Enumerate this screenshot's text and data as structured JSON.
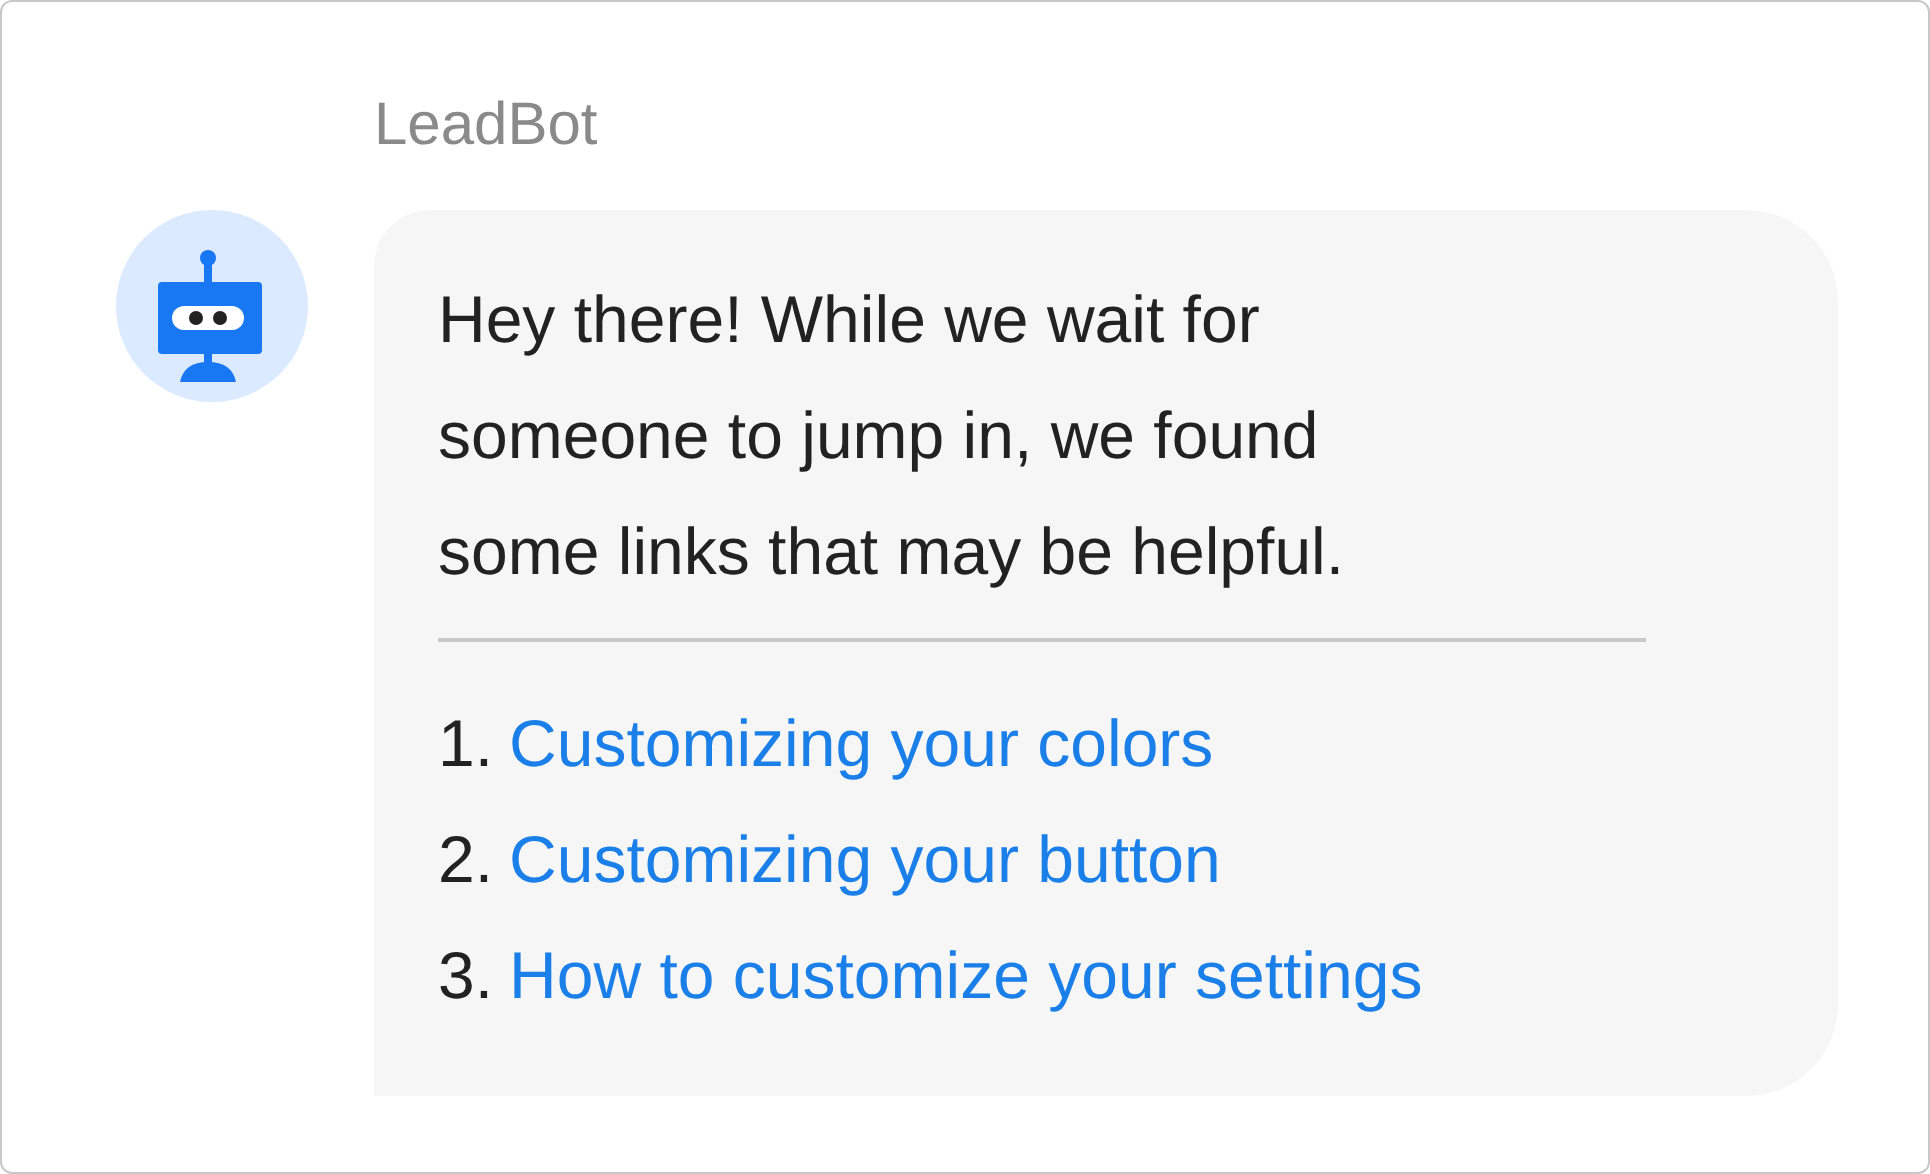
{
  "sender": "LeadBot",
  "message": [
    "Hey there! While we wait for",
    "someone to jump in, we found",
    "some links that may be helpful."
  ],
  "links": [
    {
      "number": "1.",
      "label": "Customizing your colors"
    },
    {
      "number": "2.",
      "label": "Customizing your button"
    },
    {
      "number": "3.",
      "label": "How to customize your settings"
    }
  ]
}
